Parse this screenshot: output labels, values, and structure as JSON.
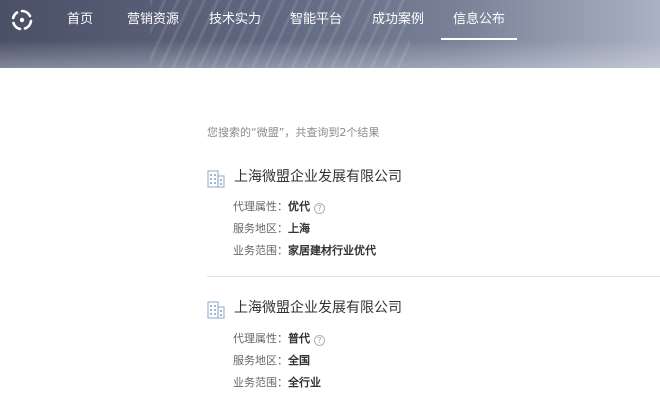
{
  "nav": {
    "items": [
      {
        "label": "首页"
      },
      {
        "label": "营销资源"
      },
      {
        "label": "技术实力"
      },
      {
        "label": "智能平台"
      },
      {
        "label": "成功案例"
      },
      {
        "label": "信息公布",
        "active": true
      }
    ]
  },
  "search": {
    "summary": "您搜索的“微盟”，共查询到2个结果"
  },
  "results": [
    {
      "name": "上海微盟企业发展有限公司",
      "agent_label": "代理属性：",
      "agent_value": "优代",
      "region_label": "服务地区：",
      "region_value": "上海",
      "scope_label": "业务范围：",
      "scope_value": "家居建材行业优代",
      "help_icon": "question-mark"
    },
    {
      "name": "上海微盟企业发展有限公司",
      "agent_label": "代理属性：",
      "agent_value": "普代",
      "region_label": "服务地区：",
      "region_value": "全国",
      "scope_label": "业务范围：",
      "scope_value": "全行业",
      "help_icon": "question-mark"
    }
  ],
  "colors": {
    "nav_text": "#ffffff",
    "accent_icon": "#9fb3d6",
    "divider": "#e2e2e2"
  }
}
